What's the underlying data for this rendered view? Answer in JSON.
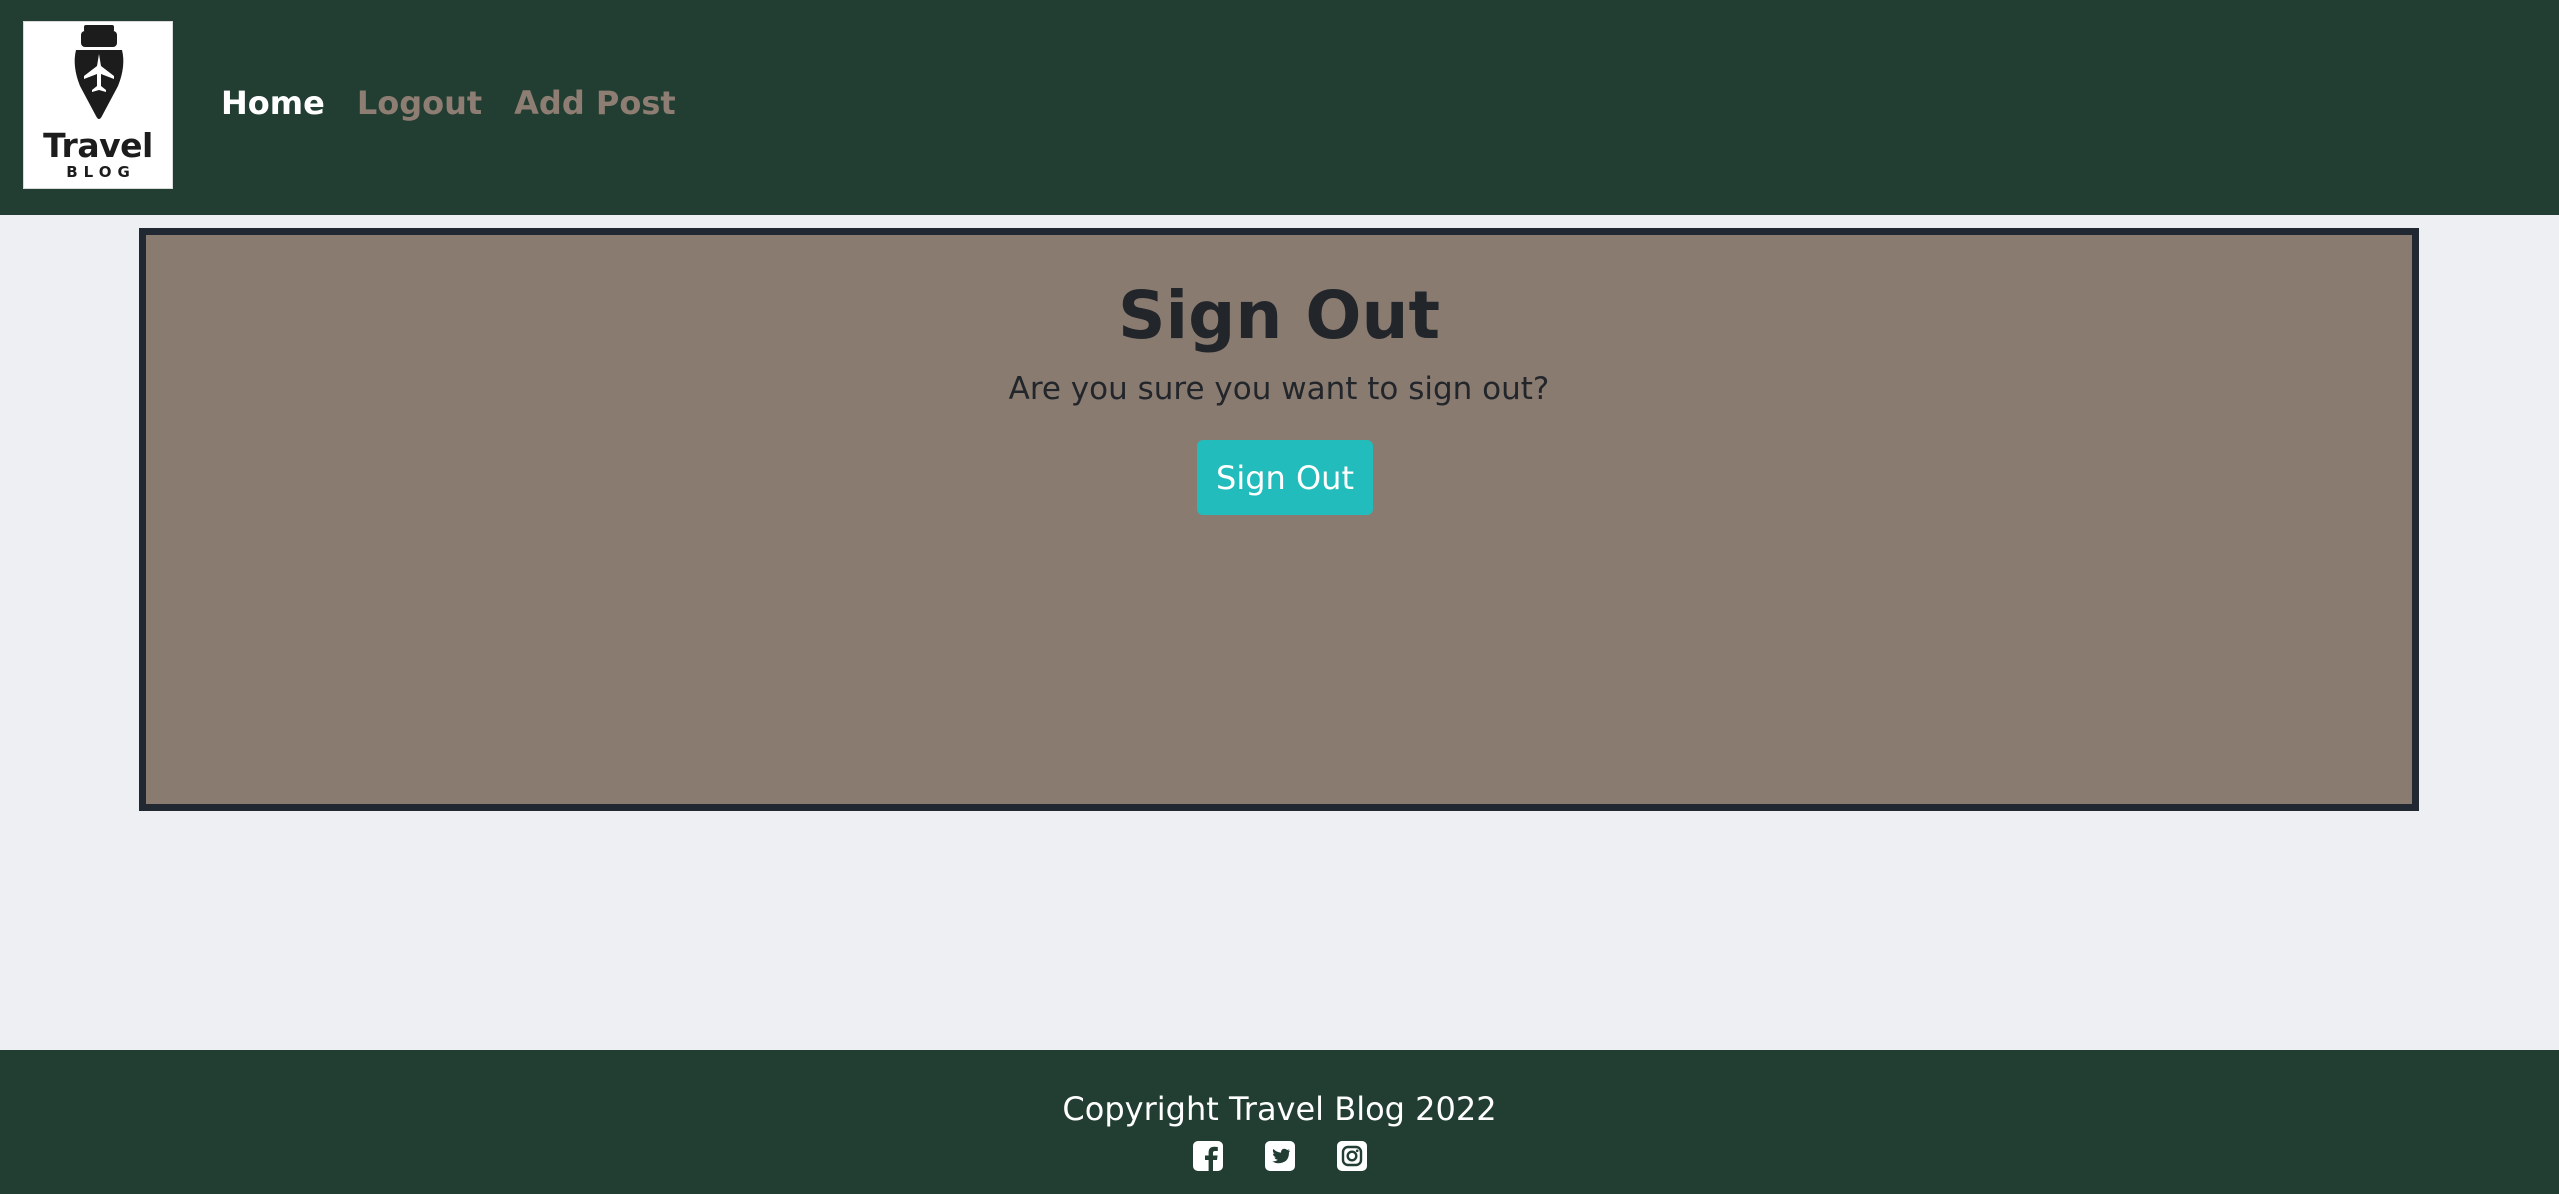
{
  "header": {
    "logo": {
      "title": "Travel",
      "subtitle": "BLOG",
      "icon": "fountain-pen-airplane-icon"
    },
    "nav": [
      {
        "label": "Home",
        "active": true
      },
      {
        "label": "Logout",
        "active": false
      },
      {
        "label": "Add Post",
        "active": false
      }
    ]
  },
  "main": {
    "title": "Sign Out",
    "message": "Are you sure you want to sign out?",
    "button_label": "Sign Out"
  },
  "footer": {
    "copyright": "Copyright Travel Blog 2022",
    "social": [
      "facebook-icon",
      "twitter-icon",
      "instagram-icon"
    ]
  },
  "colors": {
    "navbar": "#223d31",
    "page_background": "#eeeff3",
    "card_background": "#8a7b71",
    "card_border": "#212832",
    "button": "#22bcbc",
    "nav_muted": "#8e7d72"
  }
}
